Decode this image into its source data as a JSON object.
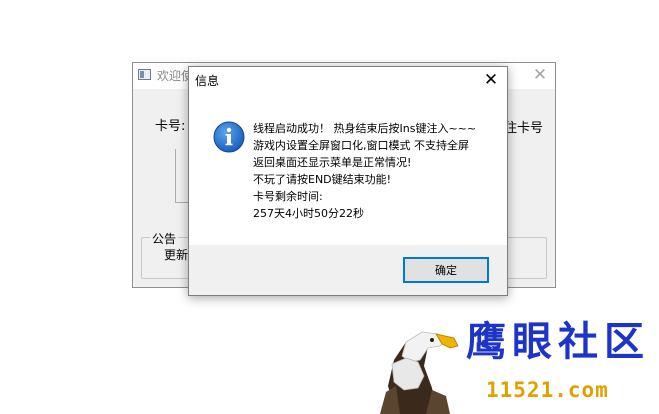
{
  "main_window": {
    "title": "欢迎使",
    "card_label": "卡号:",
    "remember_label": "住卡号",
    "notice_legend": "公告",
    "notice_text": "更新"
  },
  "message_box": {
    "title": "信息",
    "icon": "info-icon",
    "lines": [
      "线程启动成功！ 热身结束后按Ins键注入~~~",
      "游戏内设置全屏窗口化,窗口模式 不支持全屏",
      "返回桌面还显示菜单是正常情况!",
      "不玩了请按END键结束功能!",
      "卡号剩余时间:",
      "257天4小时50分22秒"
    ],
    "ok_label": "确定"
  },
  "watermark": {
    "text": "鹰眼社区",
    "url": "11521.com"
  },
  "colors": {
    "accent": "#0078d7",
    "info_icon": "#1b6fcc",
    "watermark_text": "#1d34c8",
    "watermark_url": "#e0a000"
  }
}
